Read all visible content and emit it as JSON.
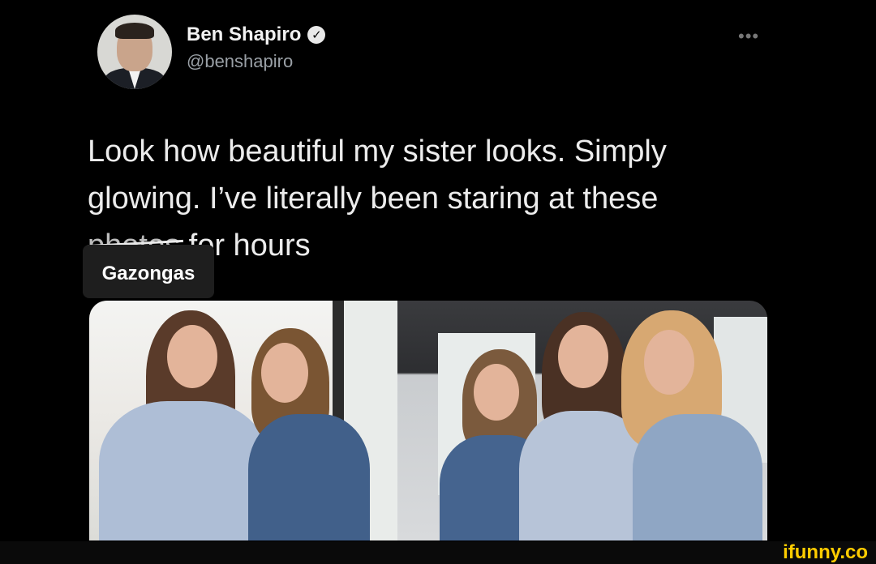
{
  "tweet": {
    "display_name": "Ben Shapiro",
    "verified_icon": "verified-badge-icon",
    "handle": "@benshapiro",
    "more_icon": "more-options-icon",
    "text_line1": "Look how beautiful my sister looks. Simply",
    "text_line2": "glowing. I’ve literally been staring at these",
    "text_strike": "photos",
    "text_line3_rest": " for hours"
  },
  "caption": {
    "label": "Gazongas"
  },
  "watermark": {
    "text": "ifunny.co",
    "color": "#ffcc00"
  },
  "colors": {
    "background": "#000000",
    "text": "#ececec",
    "handle": "#9aa0a6"
  }
}
